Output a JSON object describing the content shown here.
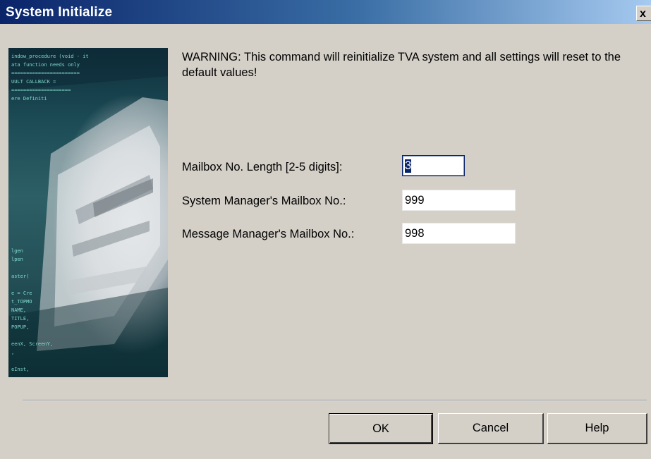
{
  "window": {
    "title": "System Initialize",
    "close_label": "x"
  },
  "side_image": {
    "description_icon": "computer-tower-code-icon",
    "code_lines": [
      "indow_procedure (void - it",
      "ata function needs only",
      "=======================",
      "UULT CALLBACK =",
      "====================",
      "ere Definiti",
      "",
      "",
      "",
      "",
      "",
      "",
      "",
      "",
      "",
      "",
      "",
      "",
      "",
      "",
      "",
      "",
      "",
      "lgen",
      "lpen",
      "",
      "aster(",
      "",
      "e = Cre",
      "t_TOPMO",
      "NAME,",
      "TITLE,",
      "POPUP,",
      "",
      "eenX, ScreenY,",
      ",",
      "",
      "eInst,"
    ]
  },
  "warning_text": "WARNING: This command will reinitialize TVA system and all settings will reset to the default values!",
  "fields": [
    {
      "label": "Mailbox No. Length [2-5 digits]:",
      "value": "3"
    },
    {
      "label": "System Manager's Mailbox No.:",
      "value": "999"
    },
    {
      "label": "Message Manager's Mailbox No.:",
      "value": "998"
    }
  ],
  "buttons": {
    "ok": "OK",
    "cancel": "Cancel",
    "help": "Help"
  },
  "colors": {
    "title_bar_start": "#0a246a",
    "title_bar_end": "#a6caf0",
    "dialog_bg": "#d4d0c8",
    "selection": "#0a246a"
  }
}
